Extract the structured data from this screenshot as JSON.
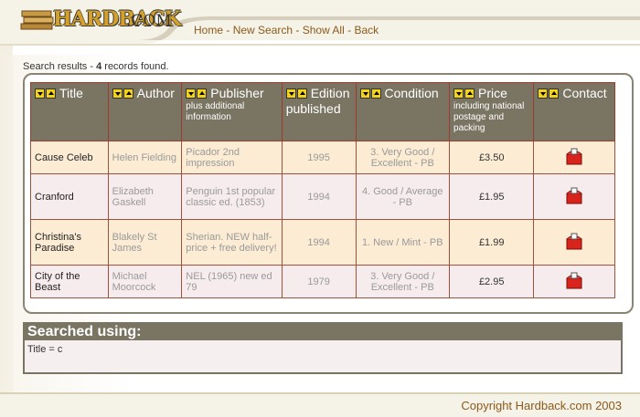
{
  "logo": {
    "text": "HARDBACK",
    "suffix": ".COM"
  },
  "nav": {
    "items": [
      {
        "label": "Home"
      },
      {
        "label": "New Search"
      },
      {
        "label": "Show All"
      },
      {
        "label": "Back"
      }
    ],
    "separator": " - "
  },
  "results": {
    "prefix": "Search results - ",
    "count": "4",
    "suffix": " records found."
  },
  "table": {
    "headers": [
      {
        "label": "Title",
        "sub": ""
      },
      {
        "label": "Author",
        "sub": ""
      },
      {
        "label": "Publisher",
        "sub": "plus additional information"
      },
      {
        "label": "Edition published",
        "sub": ""
      },
      {
        "label": "Condition",
        "sub": ""
      },
      {
        "label": "Price",
        "sub": "including national postage and packing"
      },
      {
        "label": "Contact",
        "sub": ""
      }
    ],
    "rows": [
      {
        "title": "Cause Celeb",
        "author": "Helen Fielding",
        "publisher": "Picador 2nd impression",
        "edition": "1995",
        "condition": "3. Very Good / Excellent - PB",
        "price": "£3.50"
      },
      {
        "title": "Cranford",
        "author": "Elizabeth Gaskell",
        "publisher": "Penguin 1st popular classic ed. (1853)",
        "edition": "1994",
        "condition": "4. Good / Average - PB",
        "price": "£1.95"
      },
      {
        "title": "Christina's Paradise",
        "author": "Blakely St James",
        "publisher": "Sherian. NEW half-price + free delivery!",
        "edition": "1994",
        "condition": "1. New / Mint - PB",
        "price": "£1.99"
      },
      {
        "title": "City of the Beast",
        "author": "Michael Moorcock",
        "publisher": "NEL (1965) new ed 79",
        "edition": "1979",
        "condition": "3. Very Good / Excellent - PB",
        "price": "£2.95"
      }
    ]
  },
  "searched": {
    "heading": "Searched using:",
    "query": "Title = c"
  },
  "footer": {
    "copyright": "Copyright Hardback.com 2003"
  },
  "colors": {
    "header_bg": "#7a7463",
    "accent": "#8c5a1c",
    "row_odd": "#fbecd3",
    "row_even": "#f6ecee"
  },
  "icons": {
    "sort": "sort-arrows-icon",
    "contact": "mailbox-icon"
  }
}
